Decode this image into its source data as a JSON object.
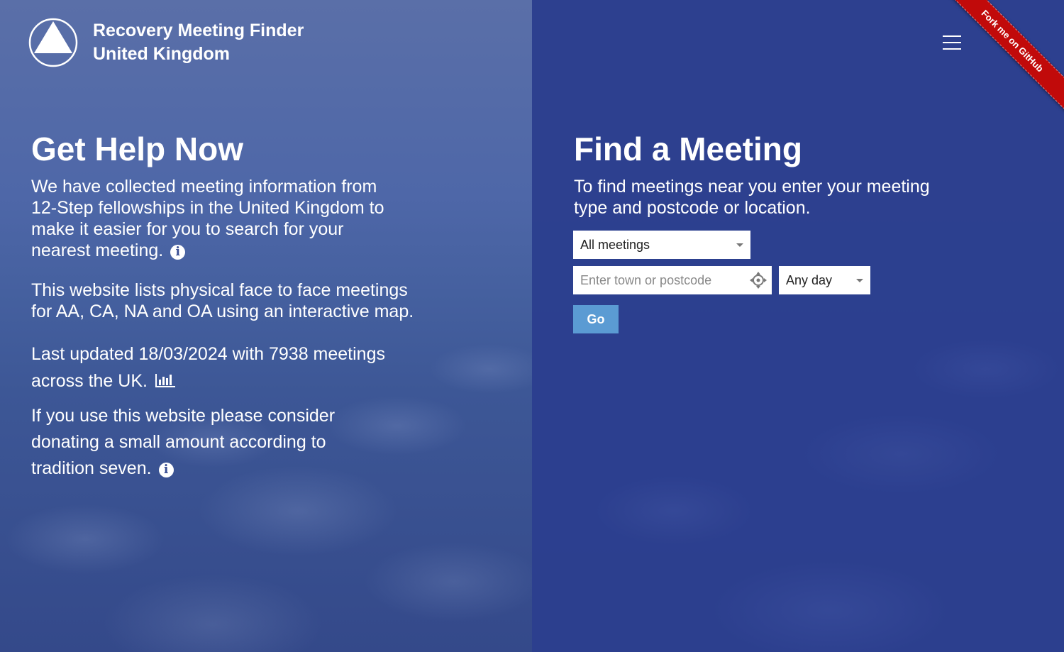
{
  "header": {
    "brand_line1": "Recovery Meeting Finder",
    "brand_line2": "United Kingdom",
    "ribbon_text": "Fork me on GitHub",
    "logo_icon": "triangle-in-circle-logo",
    "menu_icon": "hamburger-menu-icon"
  },
  "left": {
    "heading": "Get Help Now",
    "p1": "We have collected meeting information from 12-Step fellowships in the United Kingdom to make it easier for you to search for your nearest meeting.",
    "p2": "This website lists physical face to face meetings for AA, CA, NA and OA using an interactive map.",
    "p3": "Last updated 18/03/2024 with 7938 meetings across the UK.",
    "p4": "If you use this website please consider donating a small amount according to tradition seven.",
    "info_glyph": "i"
  },
  "right": {
    "heading": "Find a Meeting",
    "description": "To find meetings near you enter your meeting type and postcode or location.",
    "meeting_type_selected": "All meetings",
    "search_placeholder": "Enter town or postcode",
    "day_selected": "Any day",
    "go_label": "Go"
  },
  "colors": {
    "right_panel": "#2c3f8f",
    "go_button": "#5b9bd3",
    "ribbon": "#c10a0a"
  }
}
